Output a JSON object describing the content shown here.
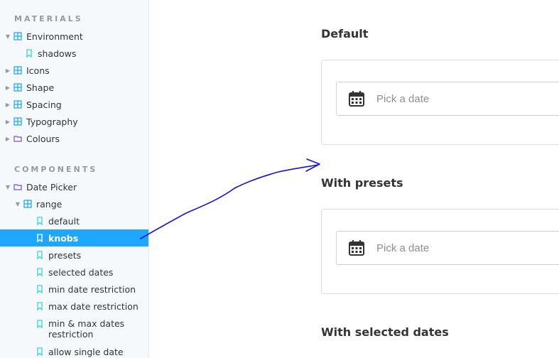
{
  "sidebar": {
    "materials_title": "MATERIALS",
    "components_title": "COMPONENTS",
    "items": [
      {
        "label": "Environment"
      },
      {
        "label": "shadows"
      },
      {
        "label": "Icons"
      },
      {
        "label": "Shape"
      },
      {
        "label": "Spacing"
      },
      {
        "label": "Typography"
      },
      {
        "label": "Colours"
      },
      {
        "label": "Date Picker"
      },
      {
        "label": "range"
      },
      {
        "label": "default"
      },
      {
        "label": "knobs"
      },
      {
        "label": "presets"
      },
      {
        "label": "selected dates"
      },
      {
        "label": "min date restriction"
      },
      {
        "label": "max date restriction"
      },
      {
        "label": "min & max dates restriction"
      },
      {
        "label": "allow single date"
      }
    ]
  },
  "main": {
    "stories": [
      {
        "heading": "Default",
        "placeholder": "Pick a date"
      },
      {
        "heading": "With presets",
        "placeholder": "Pick a date"
      },
      {
        "heading": "With selected dates"
      }
    ]
  },
  "colors": {
    "accent": "#1ea7fd",
    "annotation": "#1212e0"
  }
}
